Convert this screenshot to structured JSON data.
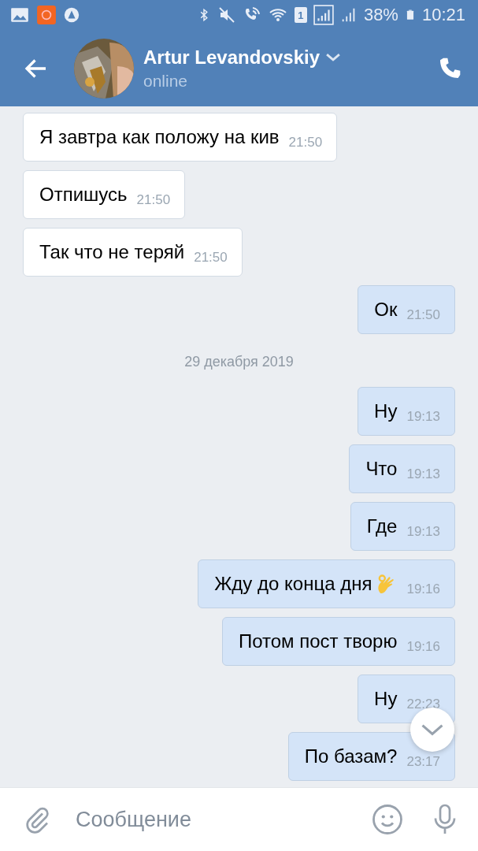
{
  "status_bar": {
    "sim_label": "1",
    "battery": "38%",
    "time": "10:21"
  },
  "header": {
    "name": "Artur Levandovskiy",
    "status": "online"
  },
  "messages": [
    {
      "kind": "incoming",
      "text": "Я завтра как положу на кив",
      "time": "21:50"
    },
    {
      "kind": "incoming",
      "text": "Отпишусь",
      "time": "21:50"
    },
    {
      "kind": "incoming",
      "text": "Так что не теряй",
      "time": "21:50"
    },
    {
      "kind": "outgoing",
      "text": "Ок",
      "time": "21:50"
    },
    {
      "kind": "date",
      "text": "29 декабря 2019"
    },
    {
      "kind": "outgoing",
      "text": "Ну",
      "time": "19:13"
    },
    {
      "kind": "outgoing",
      "text": "Что",
      "time": "19:13"
    },
    {
      "kind": "outgoing",
      "text": "Где",
      "time": "19:13"
    },
    {
      "kind": "outgoing",
      "text": "Жду до конца дня",
      "time": "19:16",
      "ok_emoji": true
    },
    {
      "kind": "outgoing",
      "text": "Потом пост творю",
      "time": "19:16"
    },
    {
      "kind": "outgoing",
      "text": "Ну",
      "time": "22:23"
    },
    {
      "kind": "outgoing",
      "text": "По базам?",
      "time": "23:17"
    }
  ],
  "composer": {
    "placeholder": "Сообщение"
  }
}
